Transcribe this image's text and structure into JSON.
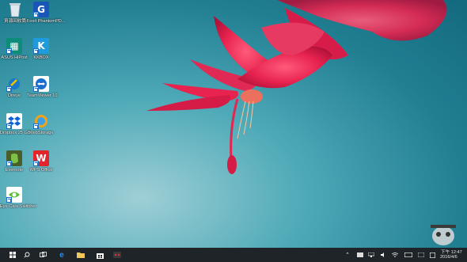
{
  "desktop_icons": [
    {
      "name": "recycle-bin-icon",
      "label": "資源回收筒"
    },
    {
      "name": "foxit-phantompdf-icon",
      "label": "Foxit PhantomPD..."
    },
    {
      "name": "asus-hipost-icon",
      "label": "ASUS HiPost"
    },
    {
      "name": "kkbox-icon",
      "label": "KKBOX"
    },
    {
      "name": "direye-icon",
      "label": "Direye"
    },
    {
      "name": "teamviewer-icon",
      "label": "TeamViewer 10"
    },
    {
      "name": "dropbox-icon",
      "label": "Dropbox 25 GB"
    },
    {
      "name": "webstorage-icon",
      "label": "WebStorage"
    },
    {
      "name": "evernote-icon",
      "label": "Evernote"
    },
    {
      "name": "wps-office-icon",
      "label": "WPS Office"
    },
    {
      "name": "eye-care-switcher-icon",
      "label": "Eye Care Switcher"
    }
  ],
  "taskbar": {
    "items": [
      "windows-start-icon",
      "search-icon",
      "task-view-icon",
      "edge-browser-icon",
      "file-explorer-icon",
      "store-icon",
      "pinned-app-icon"
    ],
    "tray": {
      "time": "下午 12:47",
      "date": "2016/4/6"
    }
  },
  "colors": {
    "wallpaper": "#2a8a9c",
    "flower": "#e8234f",
    "taskbar": "#1f2428"
  }
}
